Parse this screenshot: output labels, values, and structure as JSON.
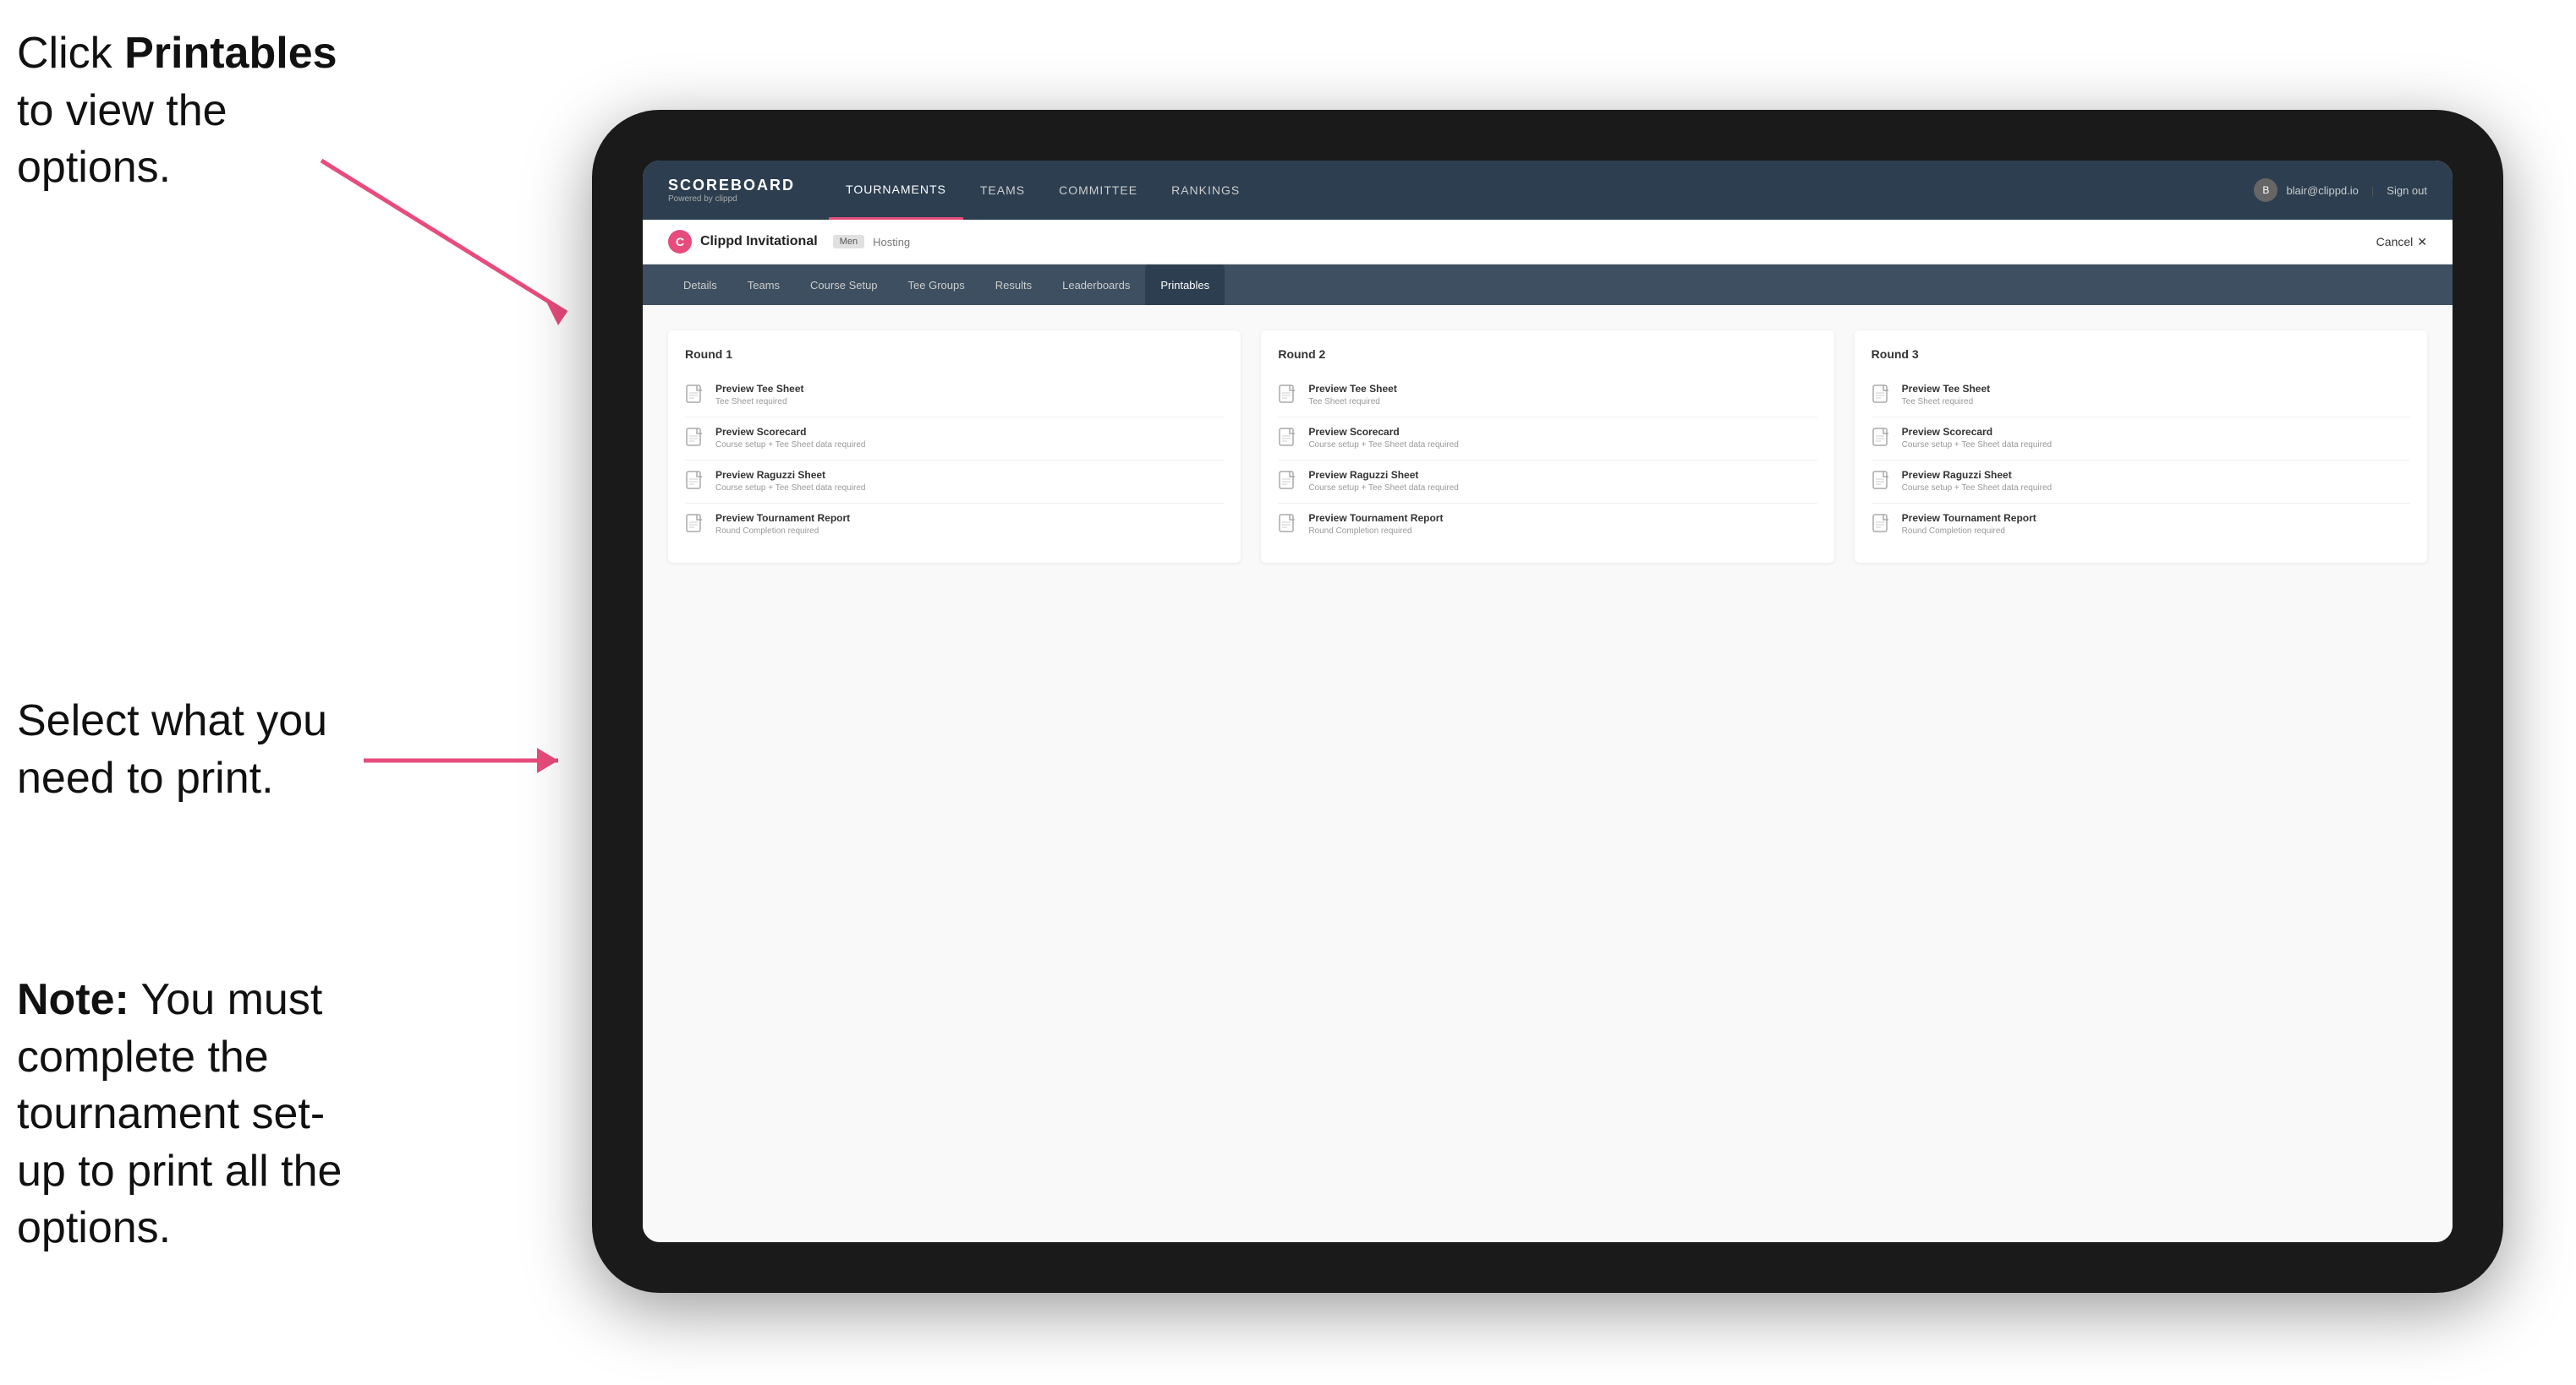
{
  "instructions": {
    "top": {
      "part1": "Click ",
      "bold": "Printables",
      "part2": " to",
      "line2": "view the options."
    },
    "middle": {
      "line1": "Select what you",
      "line2": "need to print."
    },
    "bottom": {
      "bold": "Note:",
      "text": " You must complete the tournament set-up to print all the options."
    }
  },
  "topNav": {
    "logo": {
      "title": "SCOREBOARD",
      "sub": "Powered by clippd"
    },
    "items": [
      {
        "label": "TOURNAMENTS",
        "active": false
      },
      {
        "label": "TEAMS",
        "active": false
      },
      {
        "label": "COMMITTEE",
        "active": false
      },
      {
        "label": "RANKINGS",
        "active": false
      }
    ],
    "user": {
      "email": "blair@clippd.io",
      "signOut": "Sign out"
    }
  },
  "tournamentHeader": {
    "name": "Clippd Invitational",
    "badge": "Men",
    "hosting": "Hosting",
    "cancel": "Cancel"
  },
  "subNav": {
    "items": [
      {
        "label": "Details"
      },
      {
        "label": "Teams"
      },
      {
        "label": "Course Setup"
      },
      {
        "label": "Tee Groups"
      },
      {
        "label": "Results"
      },
      {
        "label": "Leaderboards"
      },
      {
        "label": "Printables",
        "active": true
      }
    ]
  },
  "rounds": [
    {
      "title": "Round 1",
      "items": [
        {
          "label": "Preview Tee Sheet",
          "sub": "Tee Sheet required"
        },
        {
          "label": "Preview Scorecard",
          "sub": "Course setup + Tee Sheet data required"
        },
        {
          "label": "Preview Raguzzi Sheet",
          "sub": "Course setup + Tee Sheet data required"
        },
        {
          "label": "Preview Tournament Report",
          "sub": "Round Completion required"
        }
      ]
    },
    {
      "title": "Round 2",
      "items": [
        {
          "label": "Preview Tee Sheet",
          "sub": "Tee Sheet required"
        },
        {
          "label": "Preview Scorecard",
          "sub": "Course setup + Tee Sheet data required"
        },
        {
          "label": "Preview Raguzzi Sheet",
          "sub": "Course setup + Tee Sheet data required"
        },
        {
          "label": "Preview Tournament Report",
          "sub": "Round Completion required"
        }
      ]
    },
    {
      "title": "Round 3",
      "items": [
        {
          "label": "Preview Tee Sheet",
          "sub": "Tee Sheet required"
        },
        {
          "label": "Preview Scorecard",
          "sub": "Course setup + Tee Sheet data required"
        },
        {
          "label": "Preview Raguzzi Sheet",
          "sub": "Course setup + Tee Sheet data required"
        },
        {
          "label": "Preview Tournament Report",
          "sub": "Round Completion required"
        }
      ]
    }
  ]
}
